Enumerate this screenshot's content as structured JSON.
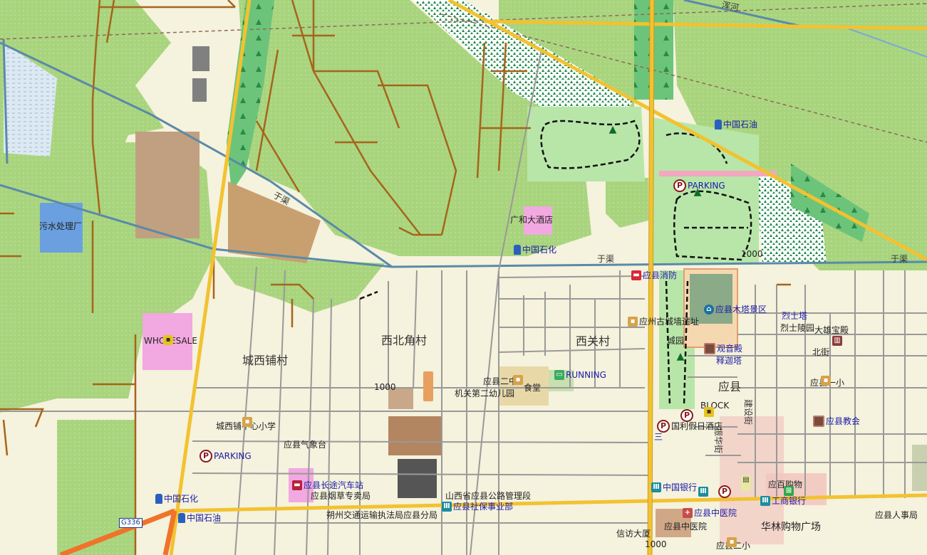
{
  "places": {
    "cheng_xi_pu_cun": "城西铺村",
    "xi_bei_jiao_cun": "西北角村",
    "xi_guan_cun": "西关村",
    "ying_xian": "应县",
    "bei_jie": "北街"
  },
  "water": {
    "yu_qu_1": "于渠",
    "yu_qu_2": "于渠",
    "yu_qu_3": "于渠",
    "hun_he": "浑河"
  },
  "contours": {
    "c1": "1000",
    "c2": "1000",
    "c3": "1000"
  },
  "road_labels": {
    "g336": "G336",
    "zhen_hua_jie": "振华街",
    "jian_she_jie": "建设街"
  },
  "pois": {
    "sewage": "污水处理厂",
    "wholesale": "WHOLESALE",
    "guanghe_hotel": "广和大酒店",
    "sinopec_center": "中国石化",
    "petrochina_ne": "中国石油",
    "parking_ne": "PARKING",
    "fire_station": "应县消防",
    "pagoda_area": "应县木塔景区",
    "lie_shi_ta": "烈士塔",
    "lie_shi_ling_yuan": "烈士陵园",
    "da_xiong_bao_dian": "大雄宝殿",
    "city_wall_ruins": "应州古城墙遗址",
    "city_garden": "城园",
    "guanyin_hall": "观音殿",
    "shijia_pagoda": "释迦塔",
    "ying_xian_no1_primary": "应县一小",
    "church": "应县教会",
    "no2_middle": "应县二中",
    "canteen": "食堂",
    "running": "RUNNING",
    "kindergarten": "机关第二幼儿园",
    "block": "BLOCK",
    "holiday_hotel": "国利假日酒店",
    "cheng_xi_primary": "城西铺中心小学",
    "weather": "应县气象台",
    "parking_w": "PARKING",
    "bus_station": "应县长途汽车站",
    "tobacco": "应县烟草专卖局",
    "sinopec_w": "中国石化",
    "petrochina_w": "中国石油",
    "highway_bureau": "山西省应县公路管理段",
    "social_security": "应县社保事业部",
    "traffic_enforcement": "朔州交通运输执法局应县分局",
    "bank_of_china": "中国银行",
    "yingbai_shopping": "应百购物",
    "icbc": "工商银行",
    "tcm_hospital": "应县中医院",
    "tcm_hospital_2": "应县中医院",
    "hualin_mall": "华林购物广场",
    "xinfang_building": "信访大厦",
    "hr_bureau": "应县人事局",
    "ying_xian_primary_s": "应县二小",
    "san": "三"
  },
  "colors": {
    "background": "#f5f2dd",
    "farmland": "#a8d47a",
    "forest": "#6fc77a",
    "primary_road": "#f2c230",
    "trunk_road": "#f0732a",
    "river": "#5a8aa8",
    "track": "#a5651b"
  }
}
